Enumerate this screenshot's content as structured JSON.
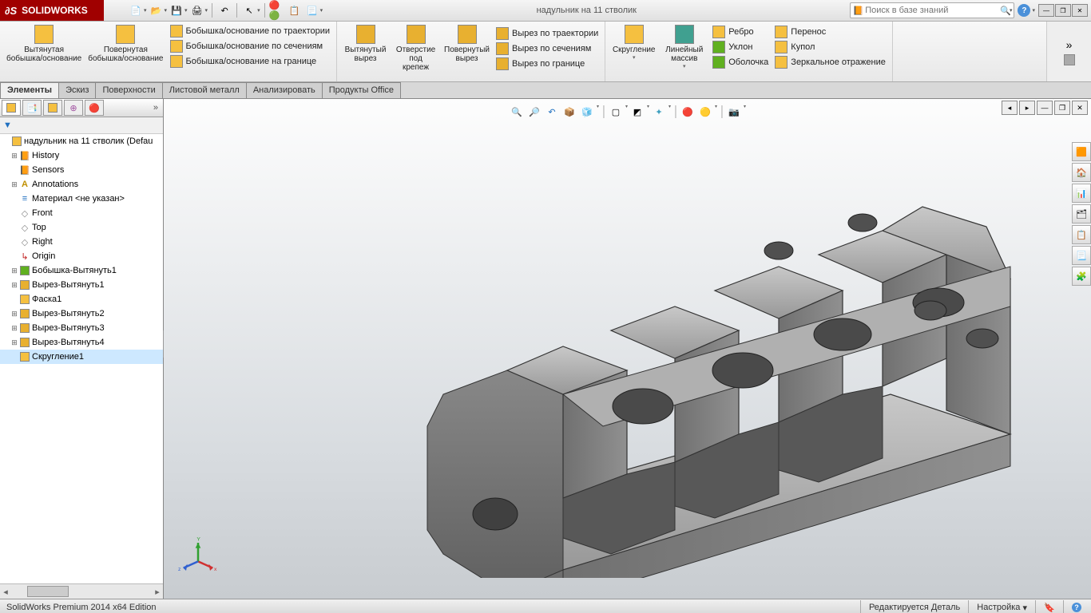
{
  "app": {
    "brand_prefix": "S",
    "brand": "SOLIDWORKS"
  },
  "title": "надульник  на 11 стволик",
  "search_placeholder": "Поиск в базе знаний",
  "ribbon": {
    "big1": "Вытянутая\nбобышка/основание",
    "big2": "Повернутая\nбобышка/основание",
    "boss_sweep": "Бобышка/основание по траектории",
    "boss_loft": "Бобышка/основание по сечениям",
    "boss_boundary": "Бобышка/основание на границе",
    "cut_extrude": "Вытянутый\nвырез",
    "hole": "Отверстие\nпод\nкрепеж",
    "cut_revolve": "Повернутый\nвырез",
    "cut_sweep": "Вырез по траектории",
    "cut_loft": "Вырез по сечениям",
    "cut_boundary": "Вырез по границе",
    "fillet": "Скругление",
    "pattern": "Линейный\nмассив",
    "rib": "Ребро",
    "draft": "Уклон",
    "shell": "Оболочка",
    "wrap": "Перенос",
    "dome": "Купол",
    "mirror": "Зеркальное отражение"
  },
  "tabs": {
    "features": "Элементы",
    "sketch": "Эскиз",
    "surfaces": "Поверхности",
    "sheetmetal": "Листовой металл",
    "evaluate": "Анализировать",
    "office": "Продукты Office"
  },
  "tree": {
    "root": "надульник  на 11 стволик  (Defau",
    "history": "History",
    "sensors": "Sensors",
    "annotations": "Annotations",
    "material": "Материал <не указан>",
    "front": "Front",
    "top": "Top",
    "right": "Right",
    "origin": "Origin",
    "f1": "Бобышка-Вытянуть1",
    "f2": "Вырез-Вытянуть1",
    "f3": "Фаска1",
    "f4": "Вырез-Вытянуть2",
    "f5": "Вырез-Вытянуть3",
    "f6": "Вырез-Вытянуть4",
    "f7": "Скругление1"
  },
  "status": {
    "edition": "SolidWorks Premium 2014 x64 Edition",
    "mode": "Редактируется Деталь",
    "custom": "Настройка"
  }
}
